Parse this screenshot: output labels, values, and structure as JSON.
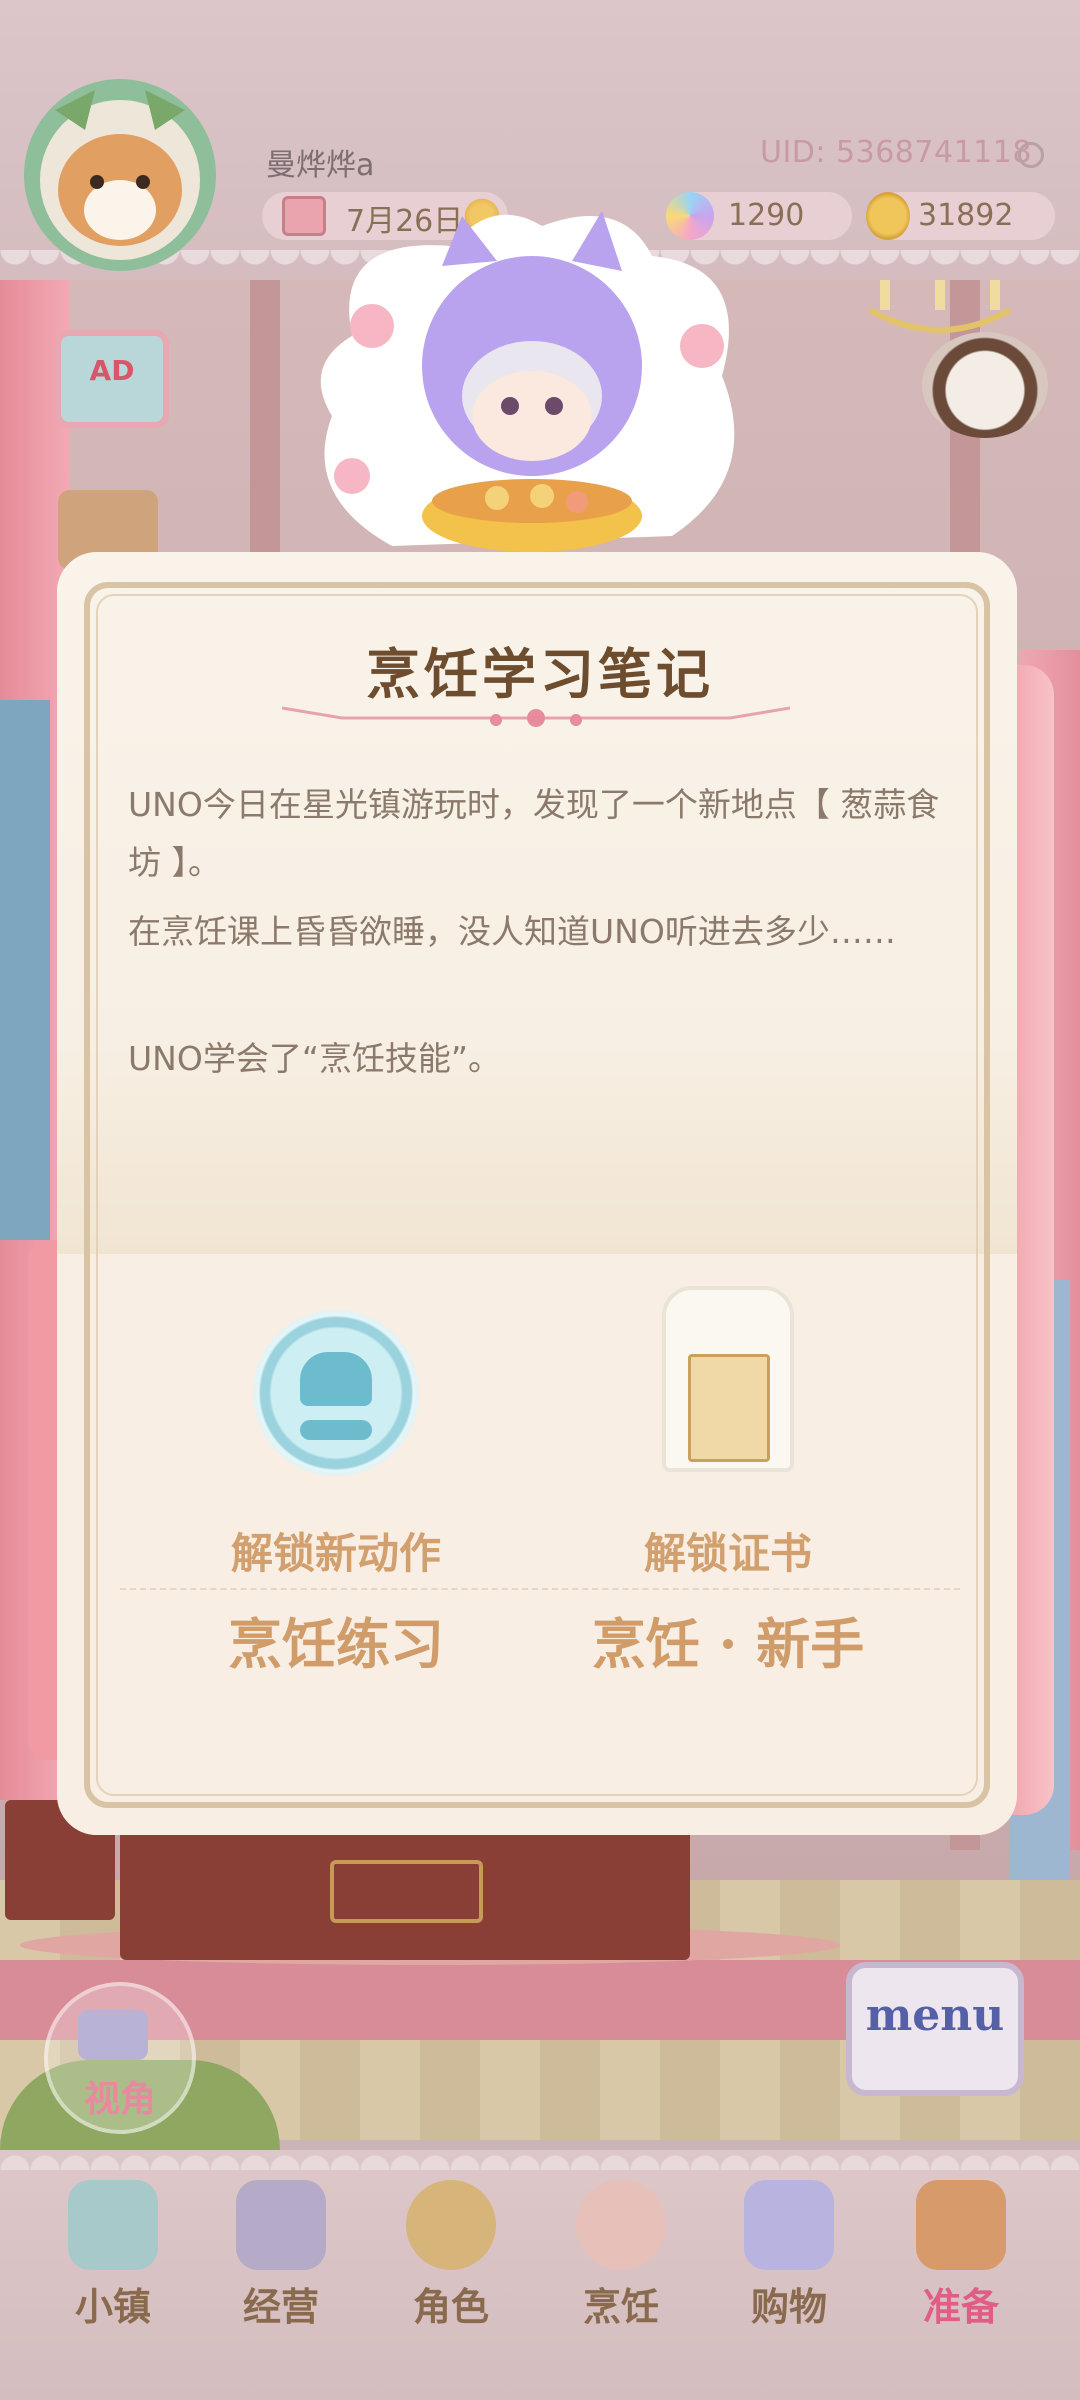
{
  "header": {
    "player_name": "曼烨烨a",
    "uid": "UID: 5368741118",
    "date": "7月26日",
    "gems": "1290",
    "coins": "31892"
  },
  "side_buttons": {
    "ad": "AD"
  },
  "modal": {
    "title": "烹饪学习笔记",
    "paragraphs": [
      "UNO今日在星光镇游玩时，发现了一个新地点【 葱蒜食坊 】。",
      "在烹饪课上昏昏欲睡，没人知道UNO听进去多少……",
      "UNO学会了“烹饪技能”。"
    ],
    "unlocks": [
      {
        "label": "解锁新动作",
        "value": "烹饪练习"
      },
      {
        "label": "解锁证书",
        "value": "烹饪 · 新手"
      }
    ]
  },
  "view_button": {
    "label": "视角"
  },
  "menu_button": {
    "label": "menu"
  },
  "nav": {
    "items": [
      {
        "label": "小镇",
        "icon": "map-icon"
      },
      {
        "label": "经营",
        "icon": "bag-lock-icon"
      },
      {
        "label": "角色",
        "icon": "character-icon"
      },
      {
        "label": "烹饪",
        "icon": "sandwich-icon"
      },
      {
        "label": "购物",
        "icon": "shopping-bag-icon"
      },
      {
        "label": "准备",
        "icon": "basket-icon"
      }
    ],
    "active": "准备"
  },
  "colors": {
    "accent_pink": "#e05d86",
    "title_brown": "#6e4c2e",
    "unlock_gold": "#cf9c6a"
  }
}
